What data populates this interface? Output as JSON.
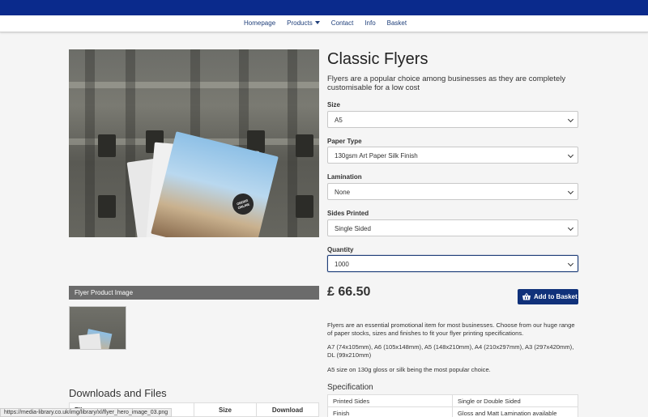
{
  "nav": {
    "items": [
      {
        "label": "Homepage"
      },
      {
        "label": "Products"
      },
      {
        "label": "Contact"
      },
      {
        "label": "Info"
      },
      {
        "label": "Basket"
      }
    ]
  },
  "product": {
    "title": "Classic Flyers",
    "intro": "Flyers are a popular choice among businesses as they are completely customisable for a low cost",
    "image_caption": "Flyer Product Image",
    "flyer_badge": "ORDER ONLINE",
    "price": "£ 66.50",
    "add_to_basket": "Add to Basket"
  },
  "options": {
    "size": {
      "label": "Size",
      "value": "A5"
    },
    "paper": {
      "label": "Paper Type",
      "value": "130gsm Art Paper Silk Finish"
    },
    "lamination": {
      "label": "Lamination",
      "value": "None"
    },
    "sides": {
      "label": "Sides Printed",
      "value": "Single Sided"
    },
    "quantity": {
      "label": "Quantity",
      "value": "1000"
    }
  },
  "description": {
    "p1": "Flyers are an essential promotional item for most businesses. Choose from our huge range of paper stocks, sizes and finishes to fit your flyer printing specifications.",
    "p2": "A7 (74x105mm), A6 (105x148mm), A5 (148x210mm), A4 (210x297mm), A3 (297x420mm), DL (99x210mm)",
    "p3": "A5 size on 130g gloss or silk being the most popular choice."
  },
  "specification": {
    "title": "Specification",
    "rows": [
      {
        "key": "Printed Sides",
        "value": "Single or Double Sided"
      },
      {
        "key": "Finish",
        "value": "Gloss and Matt Lamination available"
      }
    ]
  },
  "downloads": {
    "title": "Downloads and Files",
    "headers": [
      "File",
      "Size",
      "Download"
    ]
  },
  "status_url": "https://media-library.co.uk/img/library/xl/flyer_hero_image_03.png",
  "colors": {
    "brand": "#0a2a8c",
    "button": "#10317a"
  }
}
